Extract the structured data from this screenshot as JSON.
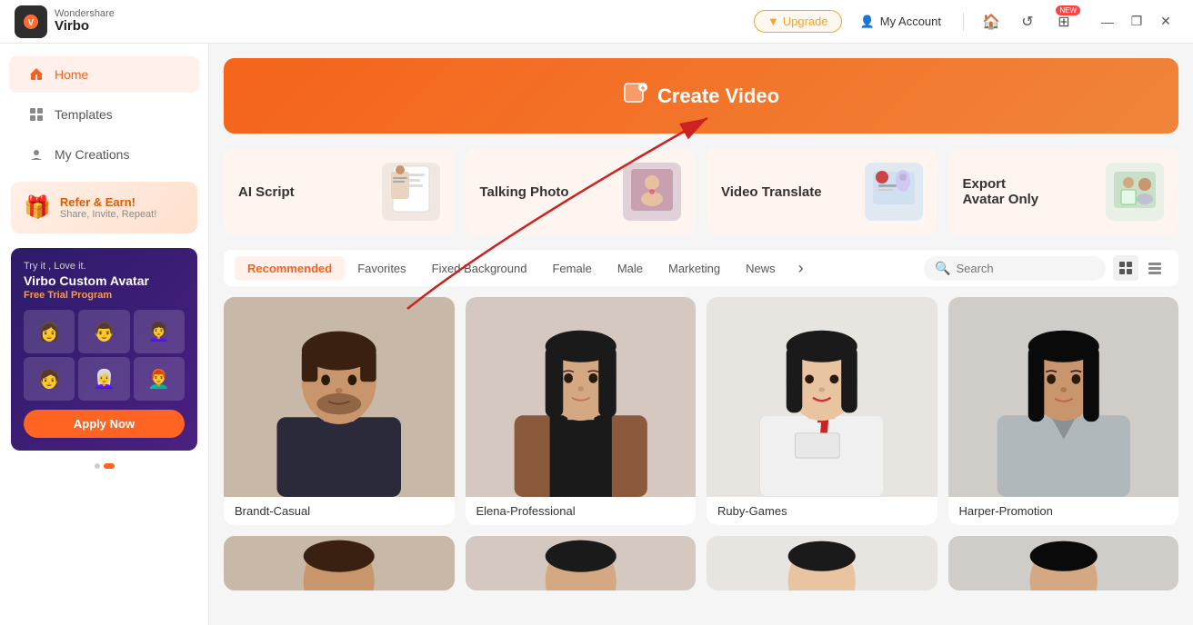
{
  "app": {
    "logo_brand": "Wondershare",
    "logo_name": "Virbo"
  },
  "titlebar": {
    "upgrade_label": "Upgrade",
    "account_label": "My Account",
    "new_badge": "NEW",
    "window_minimize": "—",
    "window_maximize": "❐",
    "window_close": "✕"
  },
  "sidebar": {
    "home_label": "Home",
    "templates_label": "Templates",
    "my_creations_label": "My Creations",
    "refer_title": "Refer & Earn!",
    "refer_sub": "Share, Invite, Repeat!",
    "custom_avatar_line1": "Try it , Love it.",
    "custom_avatar_brand": "Virbo Custom Avatar",
    "custom_avatar_sub": "Free Trial Program",
    "apply_now_label": "Apply Now"
  },
  "main": {
    "create_video_label": "Create Video",
    "features": [
      {
        "title": "AI Script",
        "icon": "📄"
      },
      {
        "title": "Talking Photo",
        "icon": "🖼️"
      },
      {
        "title": "Video Translate",
        "icon": "🌐"
      },
      {
        "title": "Export\nAvatar Only",
        "icon": "👤"
      }
    ],
    "filter_tabs": [
      {
        "label": "Recommended",
        "active": true
      },
      {
        "label": "Favorites",
        "active": false
      },
      {
        "label": "Fixed Background",
        "active": false
      },
      {
        "label": "Female",
        "active": false
      },
      {
        "label": "Male",
        "active": false
      },
      {
        "label": "Marketing",
        "active": false
      },
      {
        "label": "News",
        "active": false
      }
    ],
    "search_placeholder": "Search",
    "avatars": [
      {
        "name": "Brandt-Casual",
        "bg": "#c8b8a8",
        "skin": "#c8956c",
        "hair": "#3a2010",
        "outfit": "#2a2a3a"
      },
      {
        "name": "Elena-Professional",
        "bg": "#d4c8c0",
        "skin": "#d4a882",
        "hair": "#1a1a1a",
        "outfit": "#8b5a3c"
      },
      {
        "name": "Ruby-Games",
        "bg": "#e8e4e0",
        "skin": "#e8c4a0",
        "hair": "#1a1a1a",
        "outfit": "#fff"
      },
      {
        "name": "Harper-Promotion",
        "bg": "#d0ccc8",
        "skin": "#c8956c",
        "hair": "#0a0a0a",
        "outfit": "#c0c8cc"
      }
    ],
    "bottom_avatars": [
      {
        "name": "",
        "bg": "#c8b8a8"
      },
      {
        "name": "",
        "bg": "#d4c8c0"
      },
      {
        "name": "",
        "bg": "#e8e4e0"
      },
      {
        "name": "",
        "bg": "#d0ccc8"
      }
    ]
  }
}
